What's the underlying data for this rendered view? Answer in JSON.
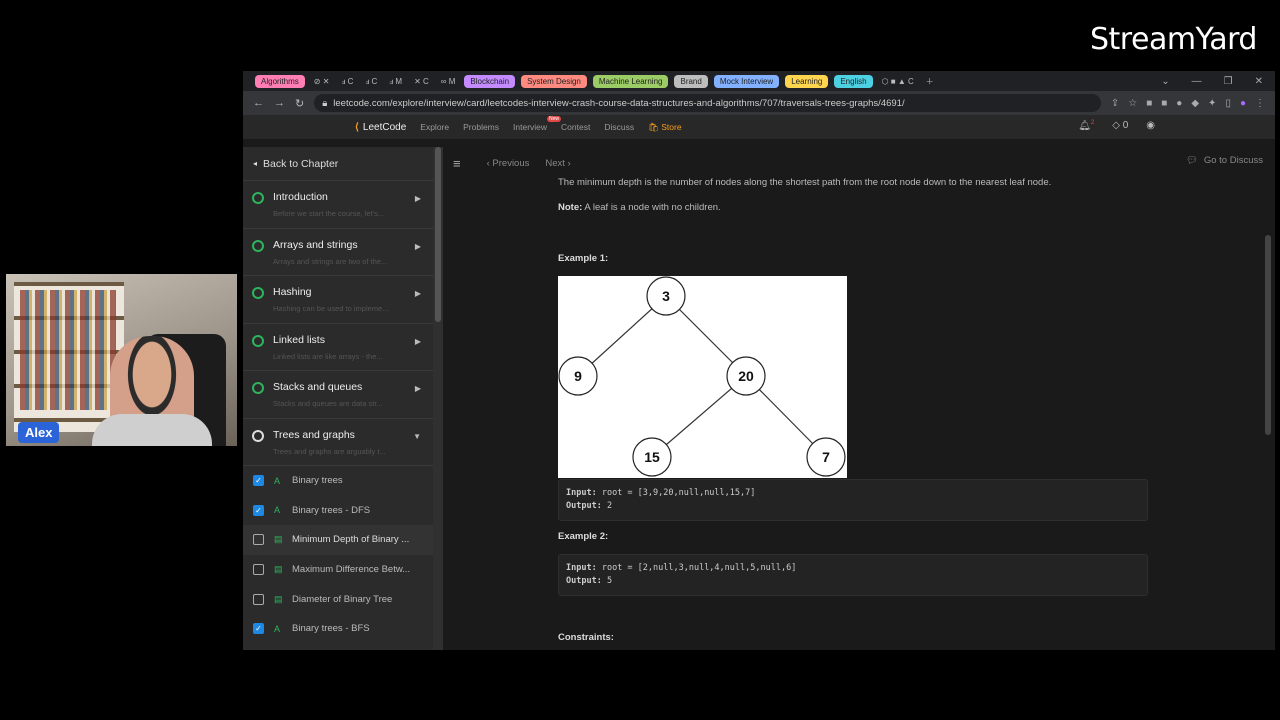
{
  "brand": "StreamYard",
  "webcam": {
    "name": "Alex"
  },
  "tabs": [
    {
      "label": "Algorithms",
      "color": "#ff7eb3"
    },
    {
      "label": "C",
      "color": "mini"
    },
    {
      "label": "Blockchain",
      "color": "#c38bff"
    },
    {
      "label": "System Design",
      "color": "#ff8a80"
    },
    {
      "label": "Machine Learning",
      "color": "#9ccc65"
    },
    {
      "label": "Brand",
      "color": "#bdbdbd"
    },
    {
      "label": "Mock Interview",
      "color": "#82b1ff"
    },
    {
      "label": "Learning",
      "color": "#ffd54f"
    },
    {
      "label": "English",
      "color": "#4dd0e1"
    }
  ],
  "address": {
    "url": "leetcode.com/explore/interview/card/leetcodes-interview-crash-course-data-structures-and-algorithms/707/traversals-trees-graphs/4691/"
  },
  "lcnav": {
    "logo": "LeetCode",
    "items": [
      "Explore",
      "Problems",
      "Interview",
      "Contest",
      "Discuss"
    ],
    "new_badge": "New",
    "store": "Store",
    "notif_count": "2",
    "streak": "0"
  },
  "sidebar": {
    "back": "Back to Chapter",
    "chapters": [
      {
        "title": "Introduction",
        "desc": "Before we start the course, let's...",
        "done": true
      },
      {
        "title": "Arrays and strings",
        "desc": "Arrays and strings are two of the...",
        "done": false
      },
      {
        "title": "Hashing",
        "desc": "Hashing can be used to impleme...",
        "done": false
      },
      {
        "title": "Linked lists",
        "desc": "Linked lists are like arrays - the...",
        "done": false
      },
      {
        "title": "Stacks and queues",
        "desc": "Stacks and queues are data str...",
        "done": false
      },
      {
        "title": "Trees and graphs",
        "desc": "Trees and graphs are arguably t...",
        "done": false,
        "open": true
      }
    ],
    "lessons": [
      {
        "label": "Binary trees",
        "checked": true,
        "type": "A"
      },
      {
        "label": "Binary trees - DFS",
        "checked": true,
        "type": "A"
      },
      {
        "label": "Minimum Depth of Binary ...",
        "checked": false,
        "type": "doc",
        "active": true
      },
      {
        "label": "Maximum Difference Betw...",
        "checked": false,
        "type": "doc"
      },
      {
        "label": "Diameter of Binary Tree",
        "checked": false,
        "type": "doc"
      },
      {
        "label": "Binary trees - BFS",
        "checked": true,
        "type": "A"
      }
    ]
  },
  "content": {
    "previous": "Previous",
    "next": "Next",
    "discuss": "Go to Discuss",
    "intro": "The minimum depth is the number of nodes along the shortest path from the root node down to the nearest leaf node.",
    "note_label": "Note:",
    "note_text": "A leaf is a node with no children.",
    "example1": "Example 1:",
    "ex1_input": "root = [3,9,20,null,null,15,7]",
    "ex1_output": "2",
    "example2": "Example 2:",
    "ex2_input": "root = [2,null,3,null,4,null,5,null,6]",
    "ex2_output": "5",
    "input_label": "Input:",
    "output_label": "Output:",
    "constraints": "Constraints:",
    "tree_nodes": [
      "3",
      "9",
      "20",
      "15",
      "7"
    ]
  }
}
